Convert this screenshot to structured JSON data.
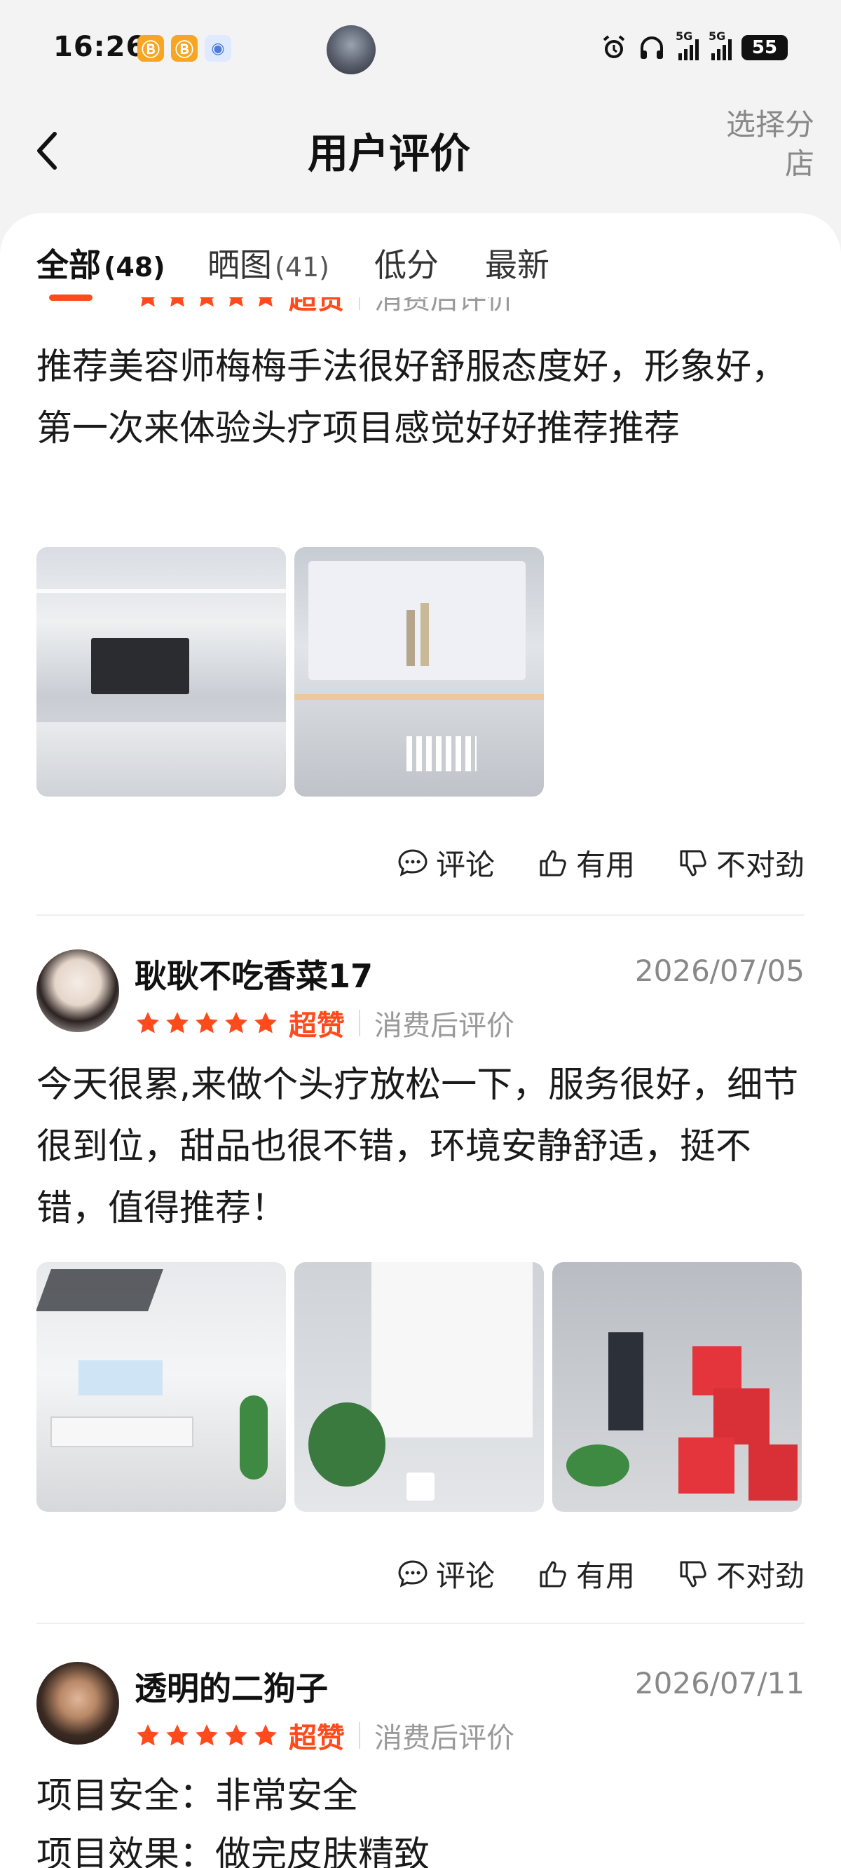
{
  "status_bar": {
    "time": "16:26",
    "app_badges": [
      "Ⓑ",
      "Ⓑ",
      "◉"
    ],
    "network": "5G",
    "network2": "5G",
    "battery": "55"
  },
  "header": {
    "title": "用户评价",
    "store_select": "选择分店"
  },
  "tabs": [
    {
      "label": "全部",
      "count": "(48)"
    },
    {
      "label": "晒图",
      "count": "(41)"
    },
    {
      "label": "低分",
      "count": ""
    },
    {
      "label": "最新",
      "count": ""
    }
  ],
  "reviews": [
    {
      "name": "",
      "date": "",
      "rating": 5,
      "rating_word": "超赞",
      "meta_note": "消费后评价",
      "text": "推荐美容师梅梅手法很好舒服态度好，形象好，第一次来体验头疗项目感觉好好推荐推荐",
      "photos": [
        "store-interior-tv-wall",
        "product-display-shelf"
      ]
    },
    {
      "name": "耿耿不吃香菜17",
      "date": "2026/07/05",
      "rating": 5,
      "rating_word": "超赞",
      "meta_note": "消费后评价",
      "text": "今天很累,来做个头疗放松一下，服务很好，细节很到位，甜品也很不错，环境安静舒适，挺不错，值得推荐！",
      "photos": [
        "reception-lobby",
        "brand-poster-plant",
        "red-gift-boxes"
      ]
    },
    {
      "name": "透明的二狗子",
      "date": "2026/07/11",
      "rating": 5,
      "rating_word": "超赞",
      "meta_note": "消费后评价",
      "lines": [
        "项目安全：非常安全",
        "项目效果：做完皮肤精致"
      ]
    }
  ],
  "actions": {
    "comment": "评论",
    "useful": "有用",
    "wrong": "不对劲"
  },
  "colors": {
    "accent": "#ff4a1c",
    "star": "#ff4a1c",
    "muted": "#888888"
  }
}
